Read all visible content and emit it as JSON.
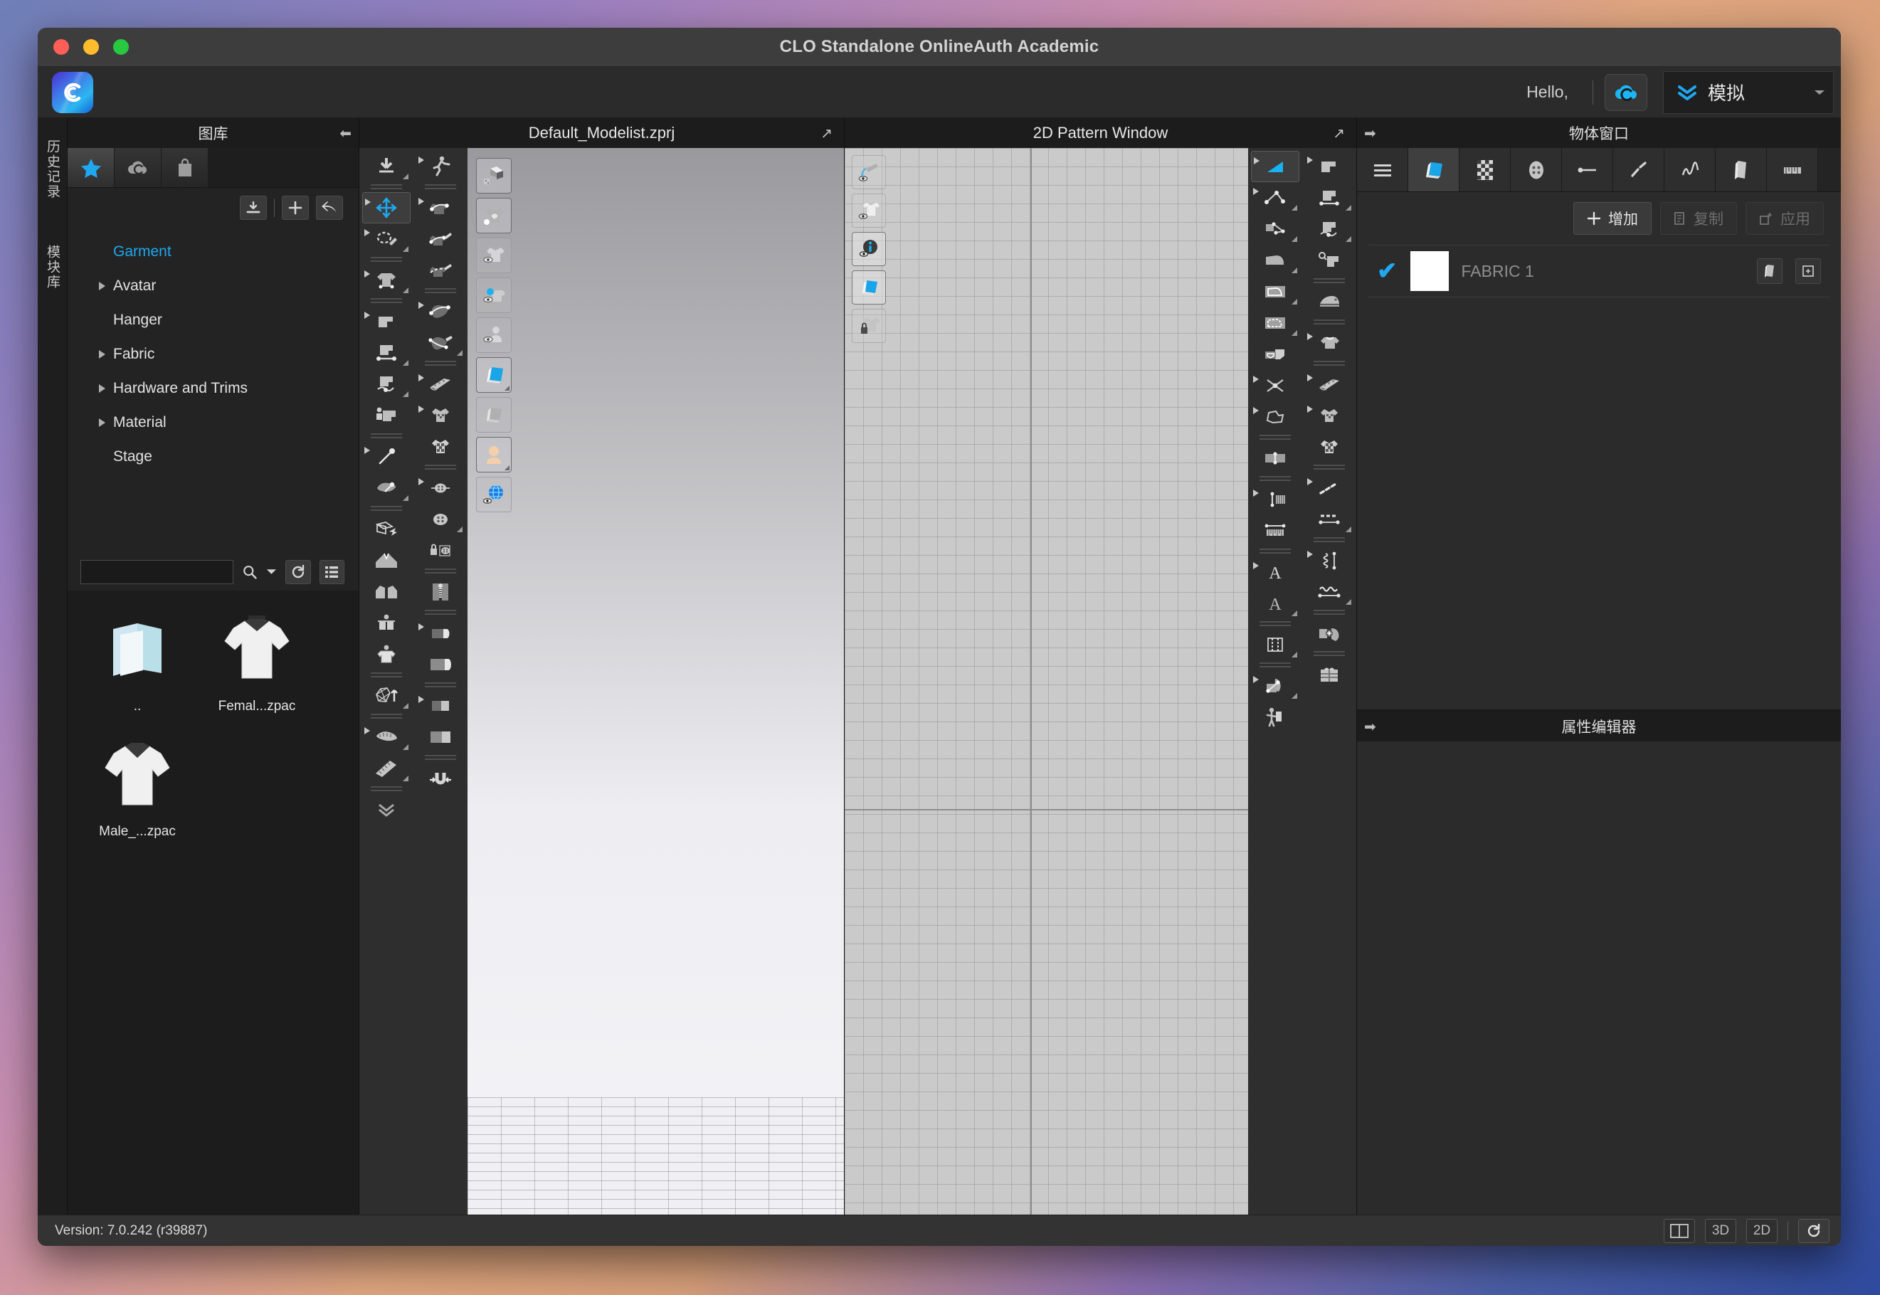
{
  "window": {
    "title": "CLO Standalone OnlineAuth Academic",
    "traffic_lights": [
      "close",
      "minimize",
      "zoom"
    ]
  },
  "topbar": {
    "logo_icon": "clo-app-icon",
    "hello_text": "Hello,",
    "cloud_button_icon": "clo-cloud-icon",
    "simulate": {
      "icon": "double-chevron-down-icon",
      "label": "模拟",
      "dropdown_icon": "caret-down-icon"
    }
  },
  "vertical_tabs": [
    {
      "label": "历史记录",
      "name": "history-tab"
    },
    {
      "label": "模块库",
      "name": "module-library-tab"
    }
  ],
  "library": {
    "header": "图库",
    "collapse_icon": "collapse-left-icon",
    "tabs": [
      {
        "icon": "star-icon",
        "active": true
      },
      {
        "icon": "clo-cloud-icon",
        "active": false
      },
      {
        "icon": "shopping-bag-icon",
        "active": false
      }
    ],
    "actions": [
      {
        "icon": "download-icon",
        "name": "download-button"
      },
      {
        "icon": "plus-icon",
        "name": "add-button"
      },
      {
        "icon": "undo-arrow-icon",
        "name": "back-button"
      }
    ],
    "tree": [
      {
        "label": "Garment",
        "root": true,
        "expandable": false
      },
      {
        "label": "Avatar",
        "root": false,
        "expandable": true
      },
      {
        "label": "Hanger",
        "root": false,
        "expandable": false
      },
      {
        "label": "Fabric",
        "root": false,
        "expandable": true
      },
      {
        "label": "Hardware and Trims",
        "root": false,
        "expandable": true
      },
      {
        "label": "Material",
        "root": false,
        "expandable": true
      },
      {
        "label": "Stage",
        "root": false,
        "expandable": false
      }
    ],
    "search": {
      "value": "",
      "placeholder": "",
      "search_icon": "search-icon",
      "dropdown_icon": "caret-down-icon",
      "refresh_icon": "refresh-icon",
      "list_view_icon": "list-view-icon"
    },
    "files": [
      {
        "name": "..",
        "thumb": "folder-up-icon"
      },
      {
        "name": "Femal...zpac",
        "thumb": "tshirt-thumb"
      },
      {
        "name": "Male_...zpac",
        "thumb": "tshirt-thumb"
      }
    ]
  },
  "panel3d": {
    "title": "Default_Modelist.zprj",
    "popout_icon": "popout-icon",
    "floating_tools": [
      {
        "icon": "show-3d-garment-icon",
        "active": false
      },
      {
        "icon": "show-garment-badge-icon",
        "active": false
      },
      {
        "icon": "show-garment-eye-icon",
        "active": false
      },
      {
        "icon": "show-pins-eye-icon",
        "active": false
      },
      {
        "icon": "show-avatar-eye-icon",
        "active": false
      },
      {
        "icon": "surface-thick-textured-icon",
        "active": true
      },
      {
        "icon": "surface-mono-icon",
        "active": false
      },
      {
        "icon": "avatar-skin-icon",
        "active": true
      },
      {
        "icon": "show-globe-eye-icon",
        "active": false
      }
    ]
  },
  "panel2d": {
    "title": "2D Pattern Window",
    "popout_icon": "popout-icon",
    "floating_tools": [
      {
        "icon": "show-baseline-eye-icon",
        "active": false
      },
      {
        "icon": "show-pattern-outline-eye-icon",
        "active": false
      },
      {
        "icon": "show-info-eye-icon",
        "active": true
      },
      {
        "icon": "show-fabric-texture-icon",
        "active": true
      },
      {
        "icon": "lock-pattern-icon",
        "active": false
      }
    ]
  },
  "object_window": {
    "header": "物体窗口",
    "expand_icon": "expand-right-icon",
    "tabs": [
      {
        "icon": "list-icon",
        "active": false,
        "name": "tab-object-list"
      },
      {
        "icon": "fabric-icon",
        "active": true,
        "name": "tab-fabric"
      },
      {
        "icon": "texture-icon",
        "active": false,
        "name": "tab-texture"
      },
      {
        "icon": "button-icon",
        "active": false,
        "name": "tab-button"
      },
      {
        "icon": "line-icon",
        "active": false,
        "name": "tab-topstitch"
      },
      {
        "icon": "stitch-icon",
        "active": false,
        "name": "tab-stitch"
      },
      {
        "icon": "elastic-icon",
        "active": false,
        "name": "tab-elastic"
      },
      {
        "icon": "fold-icon",
        "active": false,
        "name": "tab-fold"
      },
      {
        "icon": "ruler-icon",
        "active": false,
        "name": "tab-measure"
      }
    ],
    "actions": [
      {
        "label": "增加",
        "icon": "plus-icon",
        "disabled": false,
        "name": "add-fabric-button"
      },
      {
        "label": "复制",
        "icon": "copy-icon",
        "disabled": true,
        "name": "duplicate-fabric-button"
      },
      {
        "label": "应用",
        "icon": "apply-icon",
        "disabled": true,
        "name": "apply-fabric-button"
      }
    ],
    "rows": [
      {
        "checked": true,
        "swatch_color": "#ffffff",
        "name": "FABRIC 1",
        "buttons": [
          "fabric-roll-icon",
          "duplicate-icon"
        ]
      }
    ]
  },
  "property_editor": {
    "header": "属性编辑器",
    "expand_icon": "expand-right-icon"
  },
  "statusbar": {
    "version": "Version: 7.0.242 (r39887)",
    "buttons": [
      {
        "label": "",
        "icon": "split-view-icon",
        "name": "split-view-button"
      },
      {
        "label": "3D",
        "icon": "",
        "name": "view-3d-button"
      },
      {
        "label": "2D",
        "icon": "",
        "name": "view-2d-button"
      },
      {
        "label": "",
        "icon": "refresh-icon",
        "name": "reset-view-button"
      }
    ]
  },
  "colors": {
    "accent": "#1fa8f0",
    "panel_bg": "#2b2b2b",
    "header_bg": "#1c1c1c",
    "titlebar_bg": "#3d3d3d"
  }
}
